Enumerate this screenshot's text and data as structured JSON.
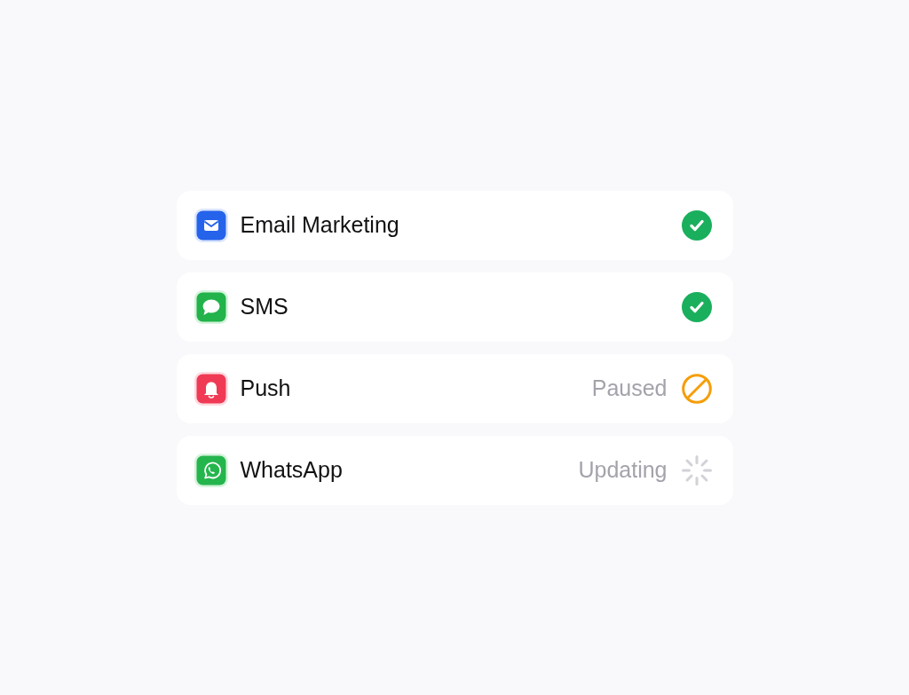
{
  "channels": [
    {
      "name": "Email Marketing",
      "kind": "email",
      "status": {
        "kind": "active"
      }
    },
    {
      "name": "SMS",
      "kind": "sms",
      "status": {
        "kind": "active"
      }
    },
    {
      "name": "Push",
      "kind": "push",
      "status": {
        "kind": "paused",
        "label": "Paused"
      }
    },
    {
      "name": "WhatsApp",
      "kind": "whatsapp",
      "status": {
        "kind": "updating",
        "label": "Updating"
      }
    }
  ]
}
